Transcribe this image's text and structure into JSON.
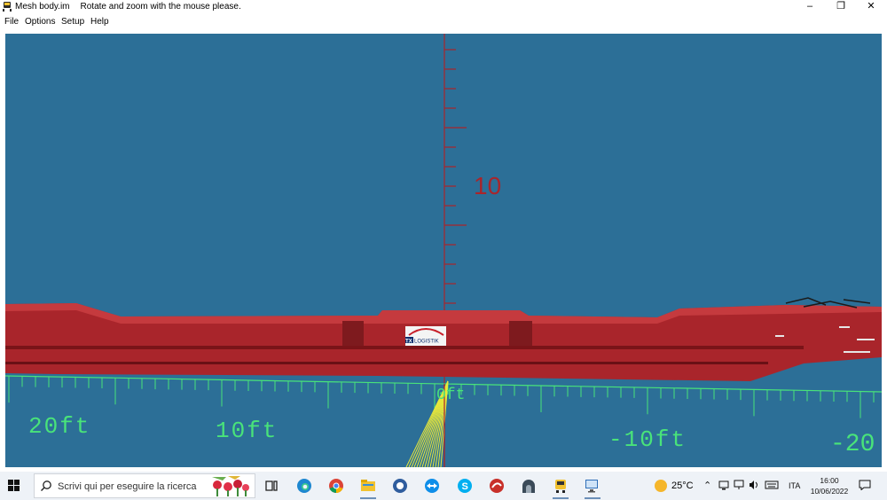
{
  "window": {
    "title": "Mesh body.im",
    "subtitle": "Rotate and zoom with the mouse please.",
    "controls": {
      "minimize": "–",
      "restore": "❐",
      "close": "✕"
    }
  },
  "menu": [
    "File",
    "Options",
    "Setup",
    "Help"
  ],
  "viewport": {
    "background": "#2C6F97",
    "vertical_axis_label": "10",
    "ground_axis_labels": [
      "20ft",
      "10ft",
      "0ft",
      "-10ft",
      "-20"
    ],
    "logo_text": {
      "tx": "TX",
      "brand": "LOGISTIK"
    },
    "wagon_color": "#A9252B",
    "grid_color": "#49E37A"
  },
  "taskbar": {
    "search_placeholder": "Scrivi qui per eseguire la ricerca",
    "apps": [
      "task-view",
      "edge",
      "chrome",
      "file-explorer",
      "generic-app",
      "teamviewer",
      "skype",
      "app-red",
      "app-tunnel",
      "app-train",
      "app-desktop"
    ],
    "weather": "25°C",
    "language": "ITA",
    "time": "16:00",
    "date": "10/06/2022"
  }
}
